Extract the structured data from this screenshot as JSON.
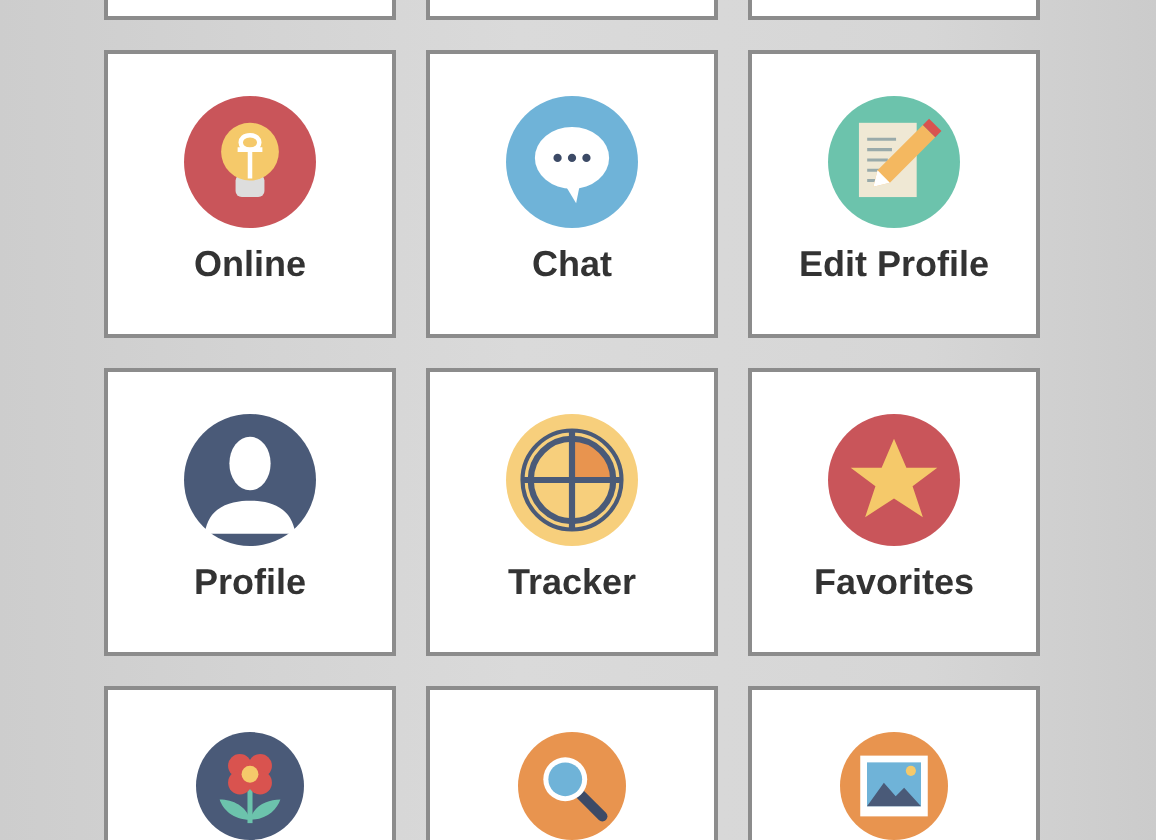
{
  "tiles": [
    {
      "kind": "blank"
    },
    {
      "kind": "blank"
    },
    {
      "kind": "blank"
    },
    {
      "kind": "bulb",
      "label": "Online"
    },
    {
      "kind": "chat",
      "label": "Chat"
    },
    {
      "kind": "edit",
      "label": "Edit Profile"
    },
    {
      "kind": "person",
      "label": "Profile"
    },
    {
      "kind": "crosshair",
      "label": "Tracker"
    },
    {
      "kind": "star",
      "label": "Favorites"
    },
    {
      "kind": "flower"
    },
    {
      "kind": "search"
    },
    {
      "kind": "image"
    }
  ]
}
